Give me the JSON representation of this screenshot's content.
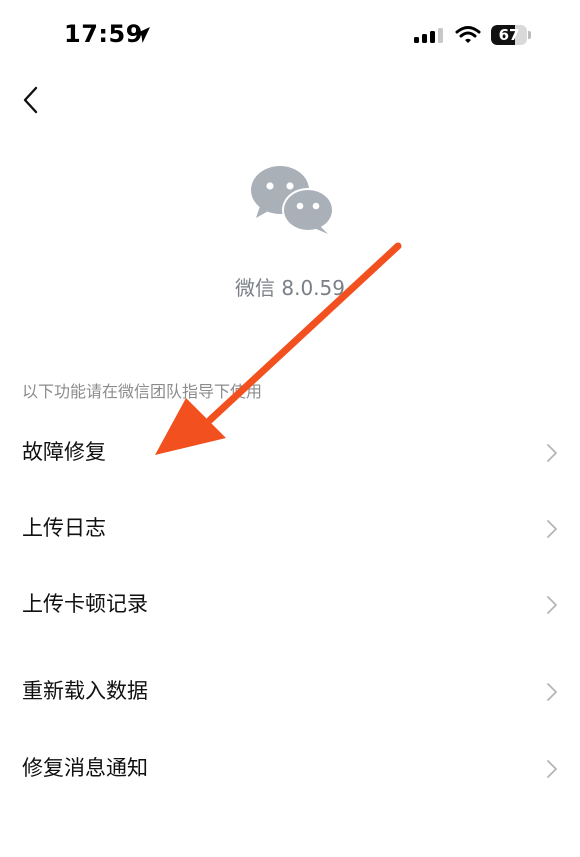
{
  "status_bar": {
    "time": "17:59",
    "battery_level": "67",
    "battery_fraction": 0.67,
    "icons": [
      "location-arrow-icon",
      "cellular-signal-icon",
      "wifi-icon",
      "battery-icon"
    ]
  },
  "nav": {
    "back_icon": "chevron-left-icon"
  },
  "app": {
    "logo_icon": "wechat-logo-icon",
    "version": "微信 8.0.59"
  },
  "section_hint": "以下功能请在微信团队指导下使用",
  "menu": [
    {
      "label": "故障修复"
    },
    {
      "label": "上传日志"
    },
    {
      "label": "上传卡顿记录"
    },
    {
      "label": "重新载入数据"
    },
    {
      "label": "修复消息通知"
    }
  ],
  "annotation": {
    "arrow_color": "#f2501f"
  },
  "colors": {
    "logo_gray": "#a9b0b8",
    "chevron": "#b5b5b5",
    "hint_text": "#8c8c8c"
  }
}
